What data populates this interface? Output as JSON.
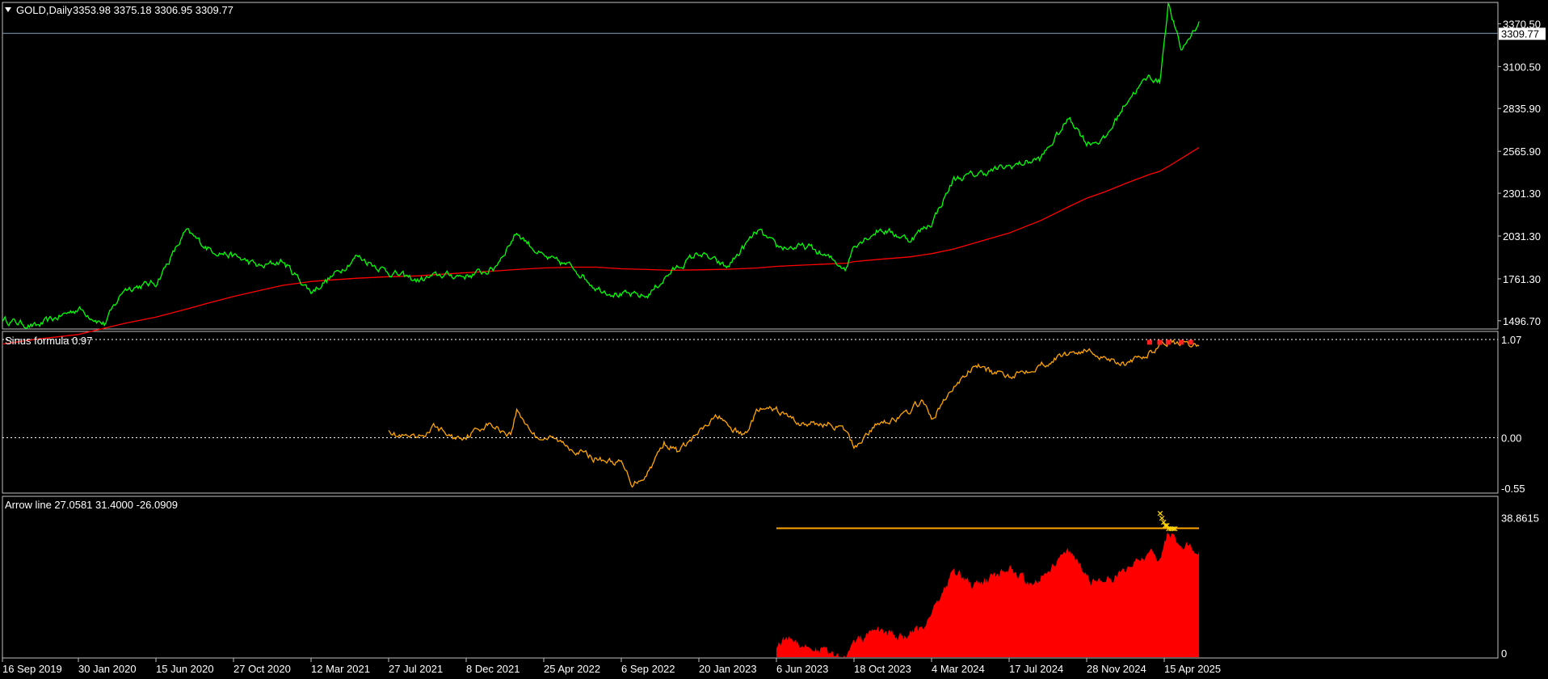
{
  "panes": {
    "main": {
      "title": "GOLD,Daily",
      "ohlc": "3353.98 3375.18 3306.95 3309.77",
      "current_price": "3309.77",
      "y_ticks": [
        "3370.50",
        "3100.50",
        "2835.90",
        "2565.90",
        "2301.30",
        "2031.30",
        "1761.30",
        "1496.70"
      ]
    },
    "sinus": {
      "title": "Sinus formula 0.97",
      "y_ticks": [
        "1.07",
        "0.00",
        "-0.55"
      ]
    },
    "arrow": {
      "title": "Arrow line 27.0581 31.4000 -26.0909",
      "y_ticks": [
        "38.8615",
        "0"
      ]
    }
  },
  "x_axis": {
    "labels": [
      "16 Sep 2019",
      "30 Jan 2020",
      "15 Jun 2020",
      "27 Oct 2020",
      "12 Mar 2021",
      "27 Jul 2021",
      "8 Dec 2021",
      "25 Apr 2022",
      "6 Sep 2022",
      "20 Jan 2023",
      "6 Jun 2023",
      "18 Oct 2023",
      "4 Mar 2024",
      "17 Jul 2024",
      "28 Nov 2024",
      "15 Apr 2025"
    ]
  },
  "colors": {
    "price": "#00ff00",
    "ma": "#ff0000",
    "sinus": "#ffa500",
    "sinus_signal": "#ff2020",
    "histogram": "#ff0000",
    "histogram_alt": "#0000ff",
    "arrow_line": "#ffa500",
    "arrow_marks": "#ffd700",
    "grid_line": "#ffffff",
    "pane_border": "#c0c0c0",
    "current_price_line": "#7f9fbf"
  },
  "chart_data": [
    {
      "type": "line",
      "pane": "main",
      "x": [
        "2019-09-16",
        "2019-11-15",
        "2020-01-30",
        "2020-03-16",
        "2020-04-20",
        "2020-06-15",
        "2020-08-06",
        "2020-09-15",
        "2020-10-27",
        "2020-12-15",
        "2021-01-20",
        "2021-03-12",
        "2021-04-20",
        "2021-06-01",
        "2021-07-27",
        "2021-09-15",
        "2021-10-25",
        "2021-12-08",
        "2022-01-25",
        "2022-03-08",
        "2022-04-25",
        "2022-06-15",
        "2022-07-25",
        "2022-09-06",
        "2022-10-20",
        "2022-12-01",
        "2023-01-20",
        "2023-03-10",
        "2023-05-04",
        "2023-06-06",
        "2023-08-01",
        "2023-10-05",
        "2023-10-18",
        "2023-12-04",
        "2024-01-25",
        "2024-03-04",
        "2024-04-12",
        "2024-05-20",
        "2024-07-17",
        "2024-09-10",
        "2024-10-30",
        "2024-11-28",
        "2024-12-30",
        "2025-02-10",
        "2025-03-20",
        "2025-04-07",
        "2025-04-22",
        "2025-05-15",
        "2025-06-16"
      ],
      "series": [
        {
          "values": [
            1505,
            1460,
            1575,
            1475,
            1700,
            1735,
            2060,
            1950,
            1905,
            1835,
            1875,
            1680,
            1780,
            1905,
            1805,
            1750,
            1785,
            1780,
            1820,
            2055,
            1895,
            1835,
            1705,
            1660,
            1650,
            1800,
            1925,
            1830,
            2065,
            1960,
            1960,
            1830,
            1980,
            2075,
            2010,
            2115,
            2390,
            2420,
            2470,
            2520,
            2780,
            2620,
            2640,
            2900,
            3040,
            3000,
            3500,
            3200,
            3385
          ]
        },
        {
          "values": [
            1350,
            1380,
            1410,
            1450,
            1480,
            1520,
            1570,
            1610,
            1650,
            1690,
            1720,
            1745,
            1755,
            1765,
            1775,
            1780,
            1790,
            1800,
            1810,
            1820,
            1830,
            1835,
            1835,
            1825,
            1820,
            1815,
            1818,
            1822,
            1830,
            1840,
            1850,
            1860,
            1870,
            1885,
            1900,
            1920,
            1950,
            1990,
            2050,
            2130,
            2220,
            2270,
            2310,
            2370,
            2420,
            2440,
            2470,
            2520,
            2590
          ]
        }
      ],
      "ylim": [
        1450,
        3500
      ]
    },
    {
      "type": "line",
      "pane": "sinus",
      "x": [
        "2021-07-27",
        "2021-08-10",
        "2021-09-15",
        "2021-10-15",
        "2021-11-15",
        "2021-12-08",
        "2022-01-15",
        "2022-02-25",
        "2022-03-08",
        "2022-04-10",
        "2022-05-15",
        "2022-06-15",
        "2022-07-20",
        "2022-09-06",
        "2022-09-25",
        "2022-10-20",
        "2022-11-20",
        "2022-12-15",
        "2023-01-20",
        "2023-02-25",
        "2023-03-10",
        "2023-04-10",
        "2023-05-04",
        "2023-06-06",
        "2023-07-20",
        "2023-09-10",
        "2023-10-05",
        "2023-10-18",
        "2023-12-04",
        "2024-01-10",
        "2024-02-15",
        "2024-03-04",
        "2024-04-12",
        "2024-05-20",
        "2024-06-20",
        "2024-07-17",
        "2024-08-20",
        "2024-09-20",
        "2024-10-30",
        "2024-11-28",
        "2024-12-30",
        "2025-02-10",
        "2025-03-20",
        "2025-04-07",
        "2025-04-22",
        "2025-05-15",
        "2025-06-16"
      ],
      "series": [
        {
          "values": [
            0.11,
            0.02,
            -0.02,
            0.12,
            0.0,
            0.02,
            0.15,
            0.04,
            0.3,
            0.02,
            -0.02,
            -0.12,
            -0.22,
            -0.28,
            -0.5,
            -0.4,
            -0.05,
            -0.15,
            0.05,
            0.25,
            0.12,
            0.02,
            0.3,
            0.3,
            0.15,
            0.15,
            0.06,
            -0.1,
            0.18,
            0.22,
            0.4,
            0.2,
            0.55,
            0.8,
            0.7,
            0.68,
            0.75,
            0.82,
            0.93,
            0.95,
            0.88,
            0.8,
            0.92,
            1.02,
            1.05,
            1.0,
            1.0
          ]
        }
      ],
      "signal_points": [
        "2025-03-20",
        "2025-04-07",
        "2025-04-22",
        "2025-05-15",
        "2025-06-01"
      ],
      "reference_lines": [
        1.07,
        0.0
      ],
      "ylim": [
        -0.55,
        1.07
      ]
    },
    {
      "type": "area",
      "pane": "arrow",
      "x": [
        "2023-06-06",
        "2023-07-01",
        "2023-08-01",
        "2023-08-25",
        "2023-09-15",
        "2023-10-05",
        "2023-10-18",
        "2023-11-15",
        "2023-12-04",
        "2024-01-10",
        "2024-02-15",
        "2024-03-04",
        "2024-04-12",
        "2024-05-20",
        "2024-06-20",
        "2024-07-17",
        "2024-08-20",
        "2024-09-20",
        "2024-10-30",
        "2024-11-28",
        "2024-12-30",
        "2025-02-10",
        "2025-03-20",
        "2025-04-07",
        "2025-04-22",
        "2025-05-15",
        "2025-06-16"
      ],
      "series": [
        {
          "values": [
            4,
            6,
            3,
            2,
            0,
            0,
            4,
            7,
            8,
            6,
            8,
            14,
            26,
            21,
            24,
            27,
            22,
            26,
            32,
            24,
            22,
            27,
            32,
            30,
            38,
            34,
            32
          ]
        }
      ],
      "arrow_marks": [
        {
          "x": "2025-04-07",
          "y": 43.5
        },
        {
          "x": "2025-04-10",
          "y": 42
        },
        {
          "x": "2025-04-13",
          "y": 40.8
        },
        {
          "x": "2025-04-16",
          "y": 39.8
        },
        {
          "x": "2025-04-19",
          "y": 39.8
        },
        {
          "x": "2025-04-22",
          "y": 38.9
        },
        {
          "x": "2025-04-26",
          "y": 38.9
        },
        {
          "x": "2025-04-30",
          "y": 38.9
        },
        {
          "x": "2025-05-03",
          "y": 38.9
        }
      ],
      "reference_line": {
        "from": "2023-06-06",
        "to": "2025-06-16",
        "value": 38.8615
      },
      "ylim": [
        0,
        48
      ]
    }
  ]
}
